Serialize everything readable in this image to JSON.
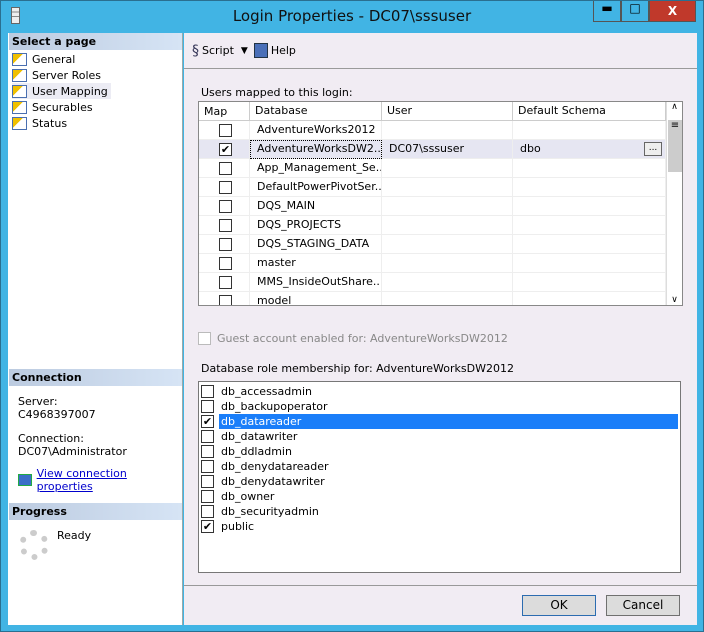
{
  "window": {
    "title": "Login Properties - DC07\\sssuser",
    "minimize": "▬",
    "maximize": "□",
    "close": "X"
  },
  "sidebar": {
    "header": "Select a page",
    "items": [
      {
        "label": "General"
      },
      {
        "label": "Server Roles"
      },
      {
        "label": "User Mapping",
        "selected": true
      },
      {
        "label": "Securables"
      },
      {
        "label": "Status"
      }
    ]
  },
  "connection": {
    "header": "Connection",
    "server_label": "Server:",
    "server": "C4968397007",
    "connection_label": "Connection:",
    "connection": "DC07\\Administrator",
    "link": "View connection properties"
  },
  "progress": {
    "header": "Progress",
    "status": "Ready"
  },
  "toolbar": {
    "script": "Script",
    "help": "Help"
  },
  "mapping": {
    "label": "Users mapped to this login:",
    "columns": [
      "Map",
      "Database",
      "User",
      "Default Schema"
    ],
    "rows": [
      {
        "map": false,
        "database": "AdventureWorks2012",
        "user": "",
        "schema": ""
      },
      {
        "map": true,
        "database": "AdventureWorksDW2...",
        "user": "DC07\\sssuser",
        "schema": "dbo"
      },
      {
        "map": false,
        "database": "App_Management_Se...",
        "user": "",
        "schema": ""
      },
      {
        "map": false,
        "database": "DefaultPowerPivotSer...",
        "user": "",
        "schema": ""
      },
      {
        "map": false,
        "database": "DQS_MAIN",
        "user": "",
        "schema": ""
      },
      {
        "map": false,
        "database": "DQS_PROJECTS",
        "user": "",
        "schema": ""
      },
      {
        "map": false,
        "database": "DQS_STAGING_DATA",
        "user": "",
        "schema": ""
      },
      {
        "map": false,
        "database": "master",
        "user": "",
        "schema": ""
      },
      {
        "map": false,
        "database": "MMS_InsideOutShare...",
        "user": "",
        "schema": ""
      },
      {
        "map": false,
        "database": "model",
        "user": "",
        "schema": ""
      }
    ],
    "browse": "..."
  },
  "guest": {
    "label": "Guest account enabled for: AdventureWorksDW2012",
    "checked": false,
    "enabled": false
  },
  "roles": {
    "label": "Database role membership for: AdventureWorksDW2012",
    "items": [
      {
        "name": "db_accessadmin",
        "checked": false
      },
      {
        "name": "db_backupoperator",
        "checked": false
      },
      {
        "name": "db_datareader",
        "checked": true,
        "selected": true
      },
      {
        "name": "db_datawriter",
        "checked": false
      },
      {
        "name": "db_ddladmin",
        "checked": false
      },
      {
        "name": "db_denydatareader",
        "checked": false
      },
      {
        "name": "db_denydatawriter",
        "checked": false
      },
      {
        "name": "db_owner",
        "checked": false
      },
      {
        "name": "db_securityadmin",
        "checked": false
      },
      {
        "name": "public",
        "checked": true
      }
    ]
  },
  "buttons": {
    "ok": "OK",
    "cancel": "Cancel"
  }
}
